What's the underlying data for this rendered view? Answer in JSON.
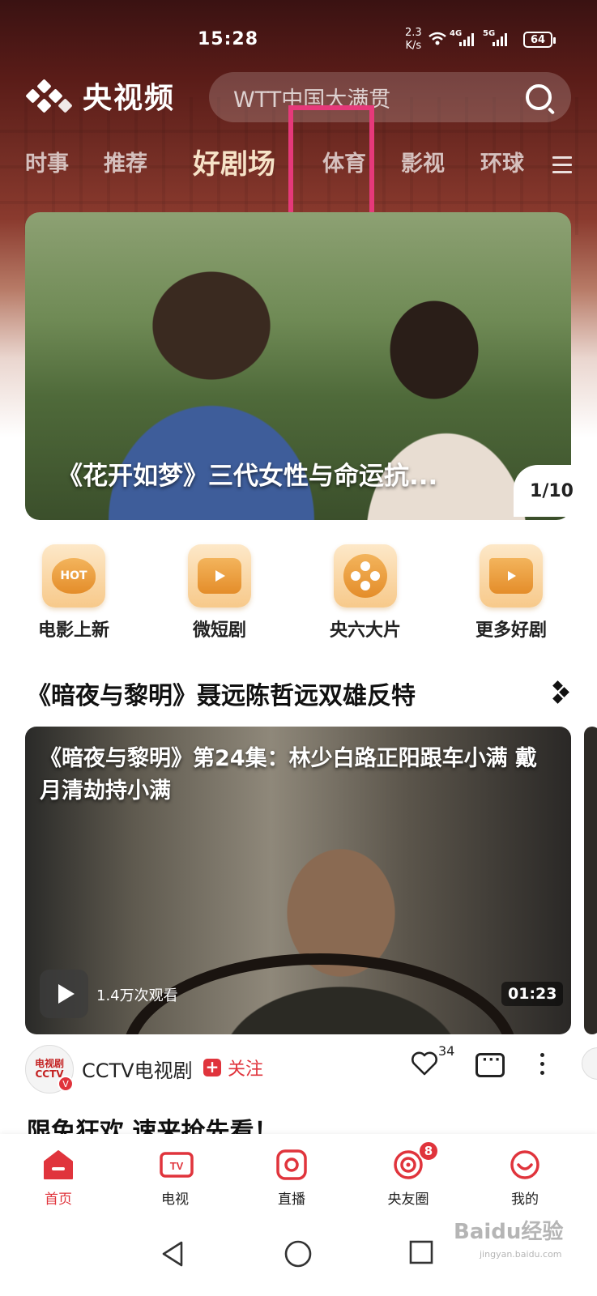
{
  "status_bar": {
    "time": "15:28",
    "net_speed_value": "2.3",
    "net_speed_unit": "K/s",
    "signal1": "4G",
    "signal2": "5G",
    "battery": "64"
  },
  "header": {
    "logo_text": "央视频",
    "search_placeholder": "WTT中国大满贯"
  },
  "tabs": [
    "时事",
    "推荐",
    "好剧场",
    "体育",
    "影视",
    "环球"
  ],
  "banner": {
    "caption": "《花开如梦》三代女性与命运抗...",
    "counter": "1/10"
  },
  "categories": [
    {
      "label": "电影上新",
      "icon": "hot-icon",
      "icon_text": "HOT"
    },
    {
      "label": "微短剧",
      "icon": "video-camera-icon"
    },
    {
      "label": "央六大片",
      "icon": "film-reel-icon"
    },
    {
      "label": "更多好剧",
      "icon": "folder-play-icon"
    }
  ],
  "section": {
    "title": "《暗夜与黎明》聂远陈哲远双雄反特",
    "video": {
      "title": "《暗夜与黎明》第24集：林少白路正阳跟车小满 戴月清劫持小满",
      "views": "1.4万次观看",
      "duration": "01:23"
    },
    "channel": {
      "name": "CCTV电视剧",
      "avatar_text": "电视剧 CCTV",
      "follow_label": "关注",
      "like_count": "34"
    }
  },
  "section2": {
    "title": "限免狂欢 速来抢先看！"
  },
  "bottom_nav": [
    {
      "label": "首页",
      "active": true
    },
    {
      "label": "电视"
    },
    {
      "label": "直播"
    },
    {
      "label": "央友圈",
      "badge": "8"
    },
    {
      "label": "我的"
    }
  ],
  "watermark": {
    "text": "Baidu经验",
    "sub": "jingyan.baidu.com"
  },
  "colors": {
    "accent": "#e0343c",
    "highlight_box": "#e6397a",
    "active_tab": "#f6e3c8"
  }
}
